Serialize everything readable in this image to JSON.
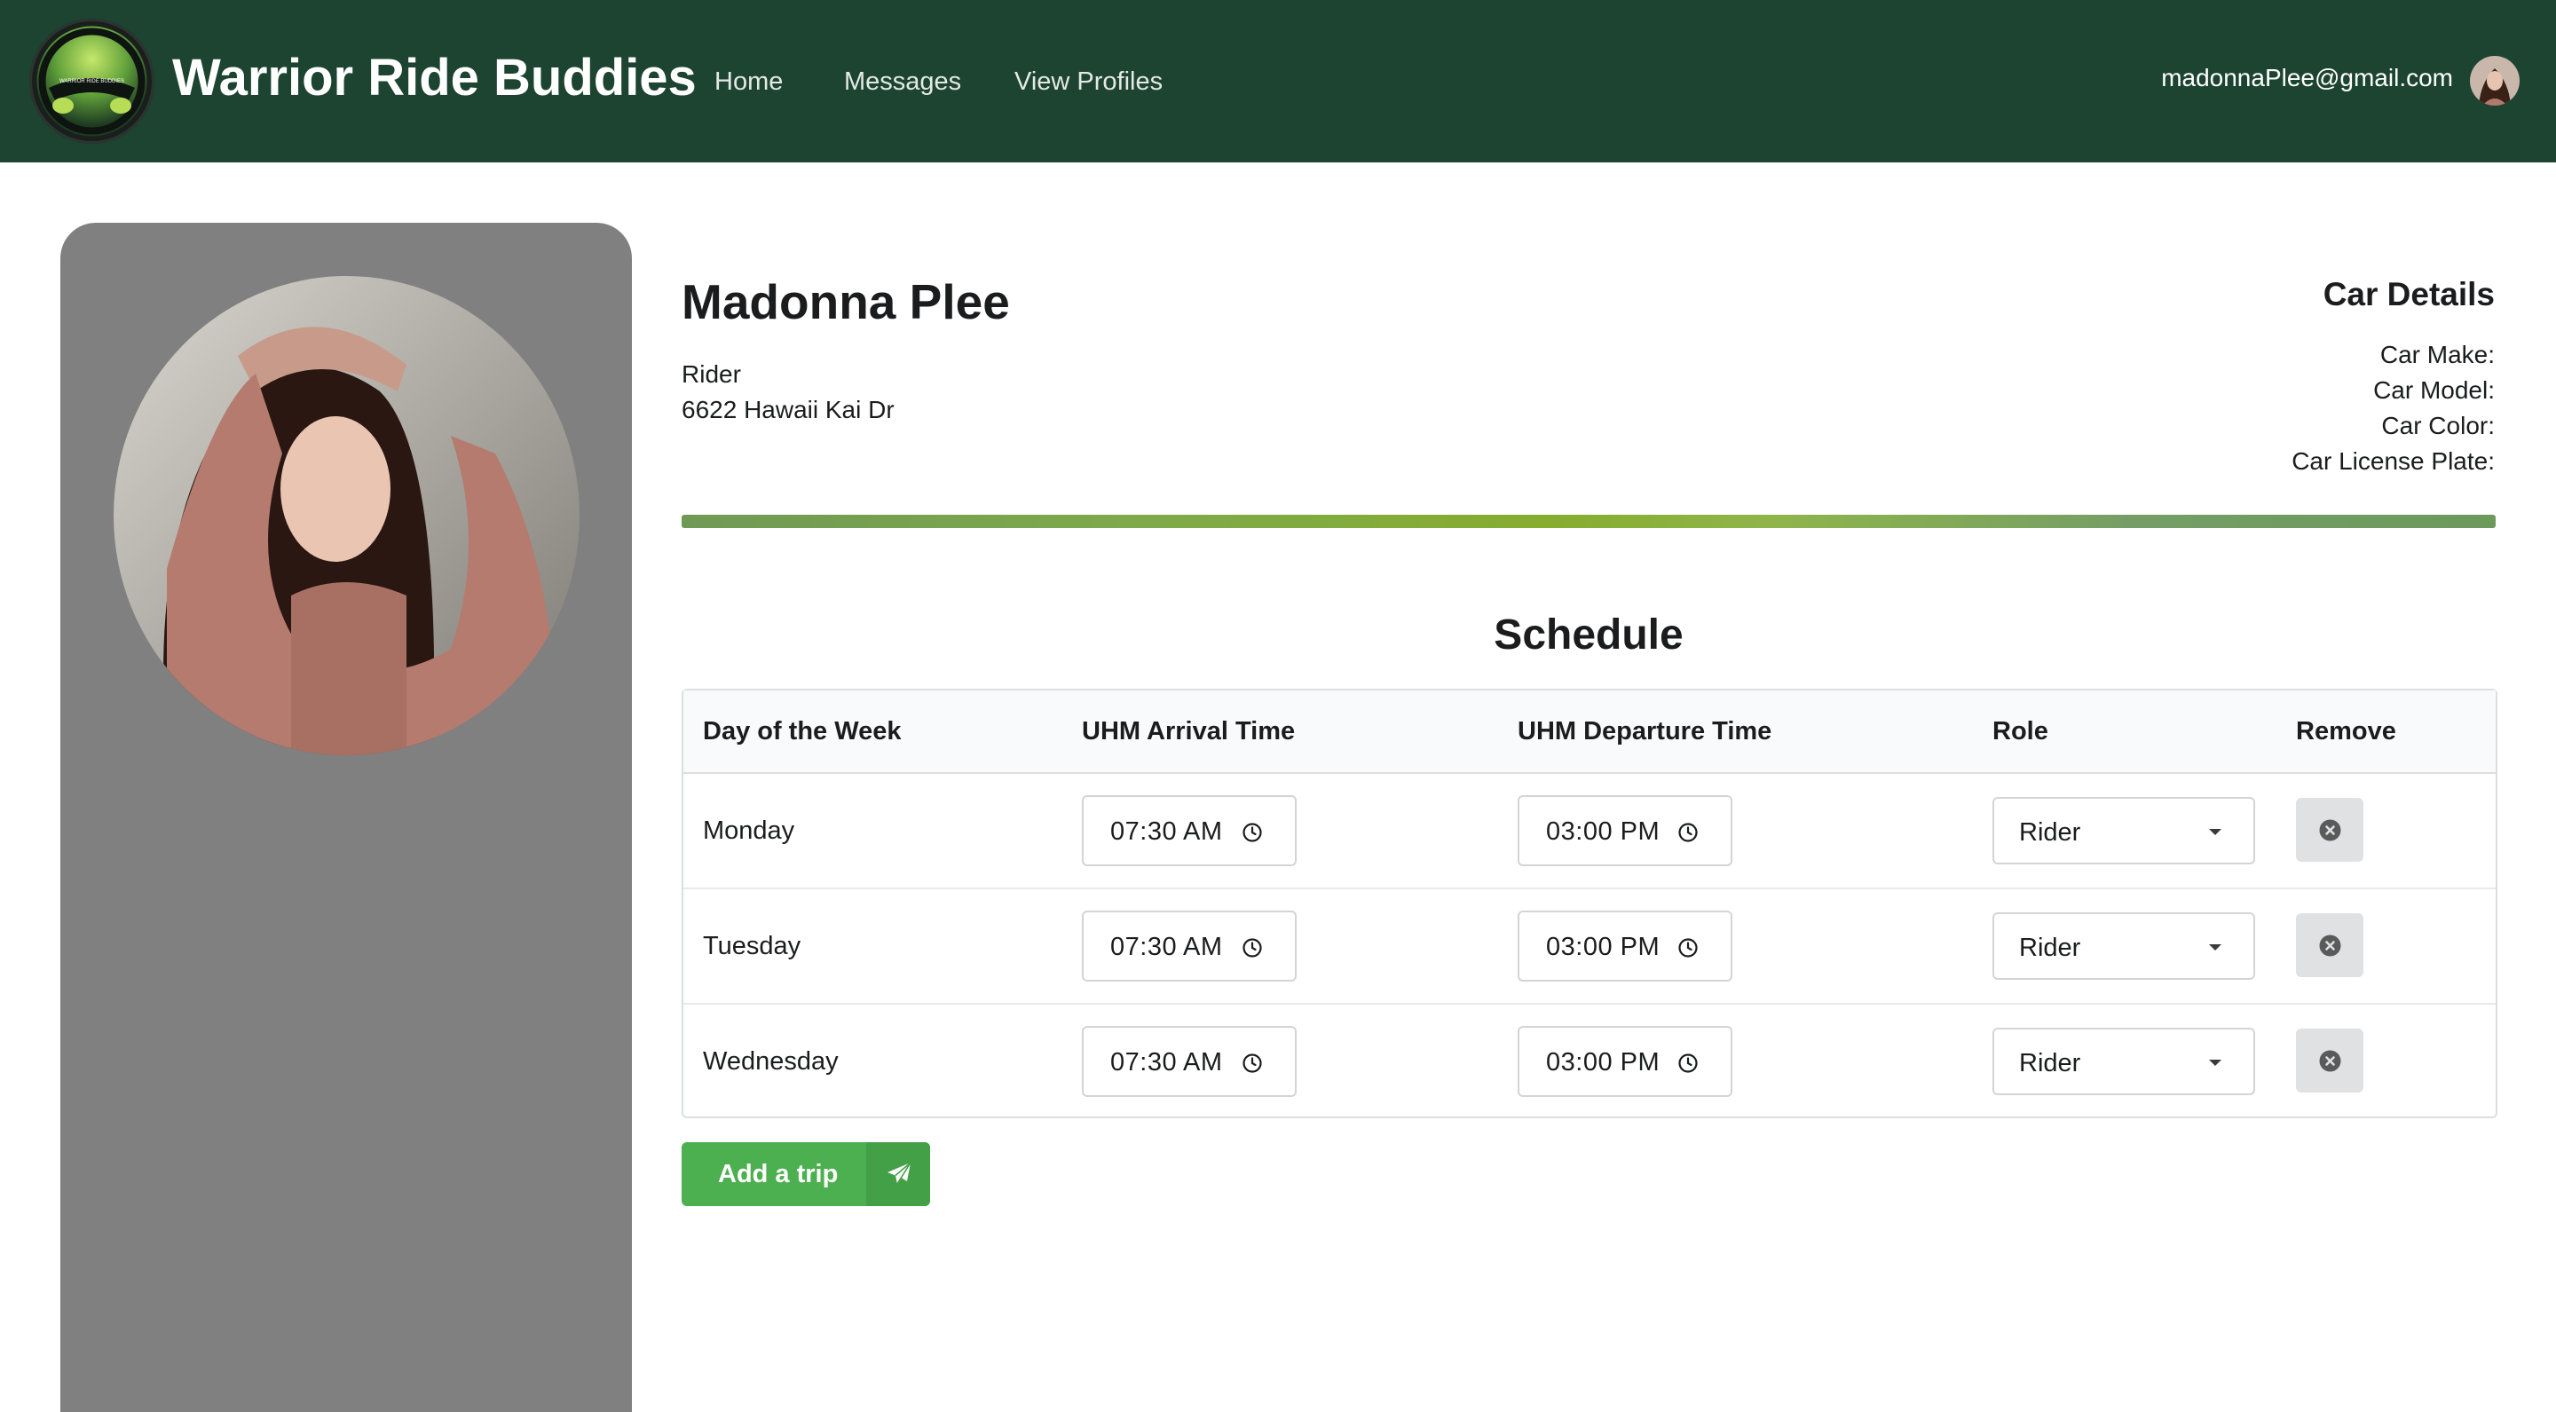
{
  "navbar": {
    "brand": "Warrior Ride Buddies",
    "logo_text": "WARRIOR RIDE BUDDIES",
    "links": [
      "Home",
      "Messages",
      "View Profiles"
    ],
    "user_email": "madonnaPlee@gmail.com"
  },
  "profile": {
    "name": "Madonna Plee",
    "role": "Rider",
    "address": "6622 Hawaii Kai Dr"
  },
  "car_details": {
    "title": "Car Details",
    "make_label": "Car Make:",
    "model_label": "Car Model:",
    "color_label": "Car Color:",
    "plate_label": "Car License Plate:"
  },
  "schedule": {
    "title": "Schedule",
    "headers": [
      "Day of the Week",
      "UHM Arrival Time",
      "UHM Departure Time",
      "Role",
      "Remove"
    ],
    "rows": [
      {
        "day": "Monday",
        "arrival": "07:30 AM",
        "departure": "03:00 PM",
        "role": "Rider"
      },
      {
        "day": "Tuesday",
        "arrival": "07:30 AM",
        "departure": "03:00 PM",
        "role": "Rider"
      },
      {
        "day": "Wednesday",
        "arrival": "07:30 AM",
        "departure": "03:00 PM",
        "role": "Rider"
      }
    ]
  },
  "actions": {
    "add_trip": "Add a trip"
  },
  "colors": {
    "navbar": "#1c4431",
    "accent_green": "#4caf50",
    "sidebar": "#808080"
  }
}
